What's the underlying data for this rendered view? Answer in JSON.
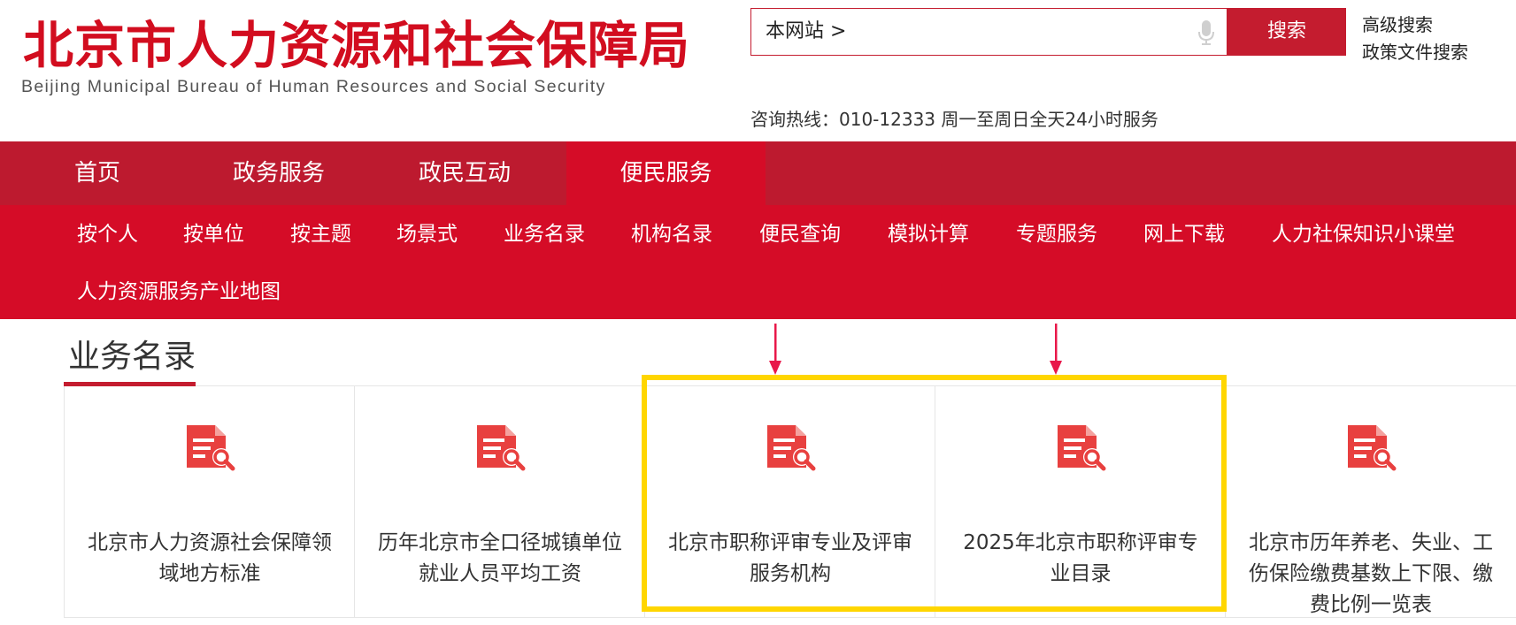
{
  "header": {
    "logo_cn": "北京市人力资源和社会保障局",
    "logo_en": "Beijing Municipal Bureau of Human Resources and Social Security",
    "search_scope": "本网站 >",
    "search_button": "搜索",
    "advanced_search": "高级搜索",
    "policy_search": "政策文件搜索",
    "hotline": "咨询热线：010-12333 周一至周日全天24小时服务"
  },
  "nav_main": {
    "tabs": [
      {
        "label": "首页"
      },
      {
        "label": "政务服务"
      },
      {
        "label": "政民互动"
      },
      {
        "label": "便民服务",
        "active": true
      }
    ]
  },
  "nav_sub": {
    "items": [
      {
        "label": "按个人"
      },
      {
        "label": "按单位"
      },
      {
        "label": "按主题"
      },
      {
        "label": "场景式"
      },
      {
        "label": "业务名录"
      },
      {
        "label": "机构名录"
      },
      {
        "label": "便民查询"
      },
      {
        "label": "模拟计算"
      },
      {
        "label": "专题服务"
      },
      {
        "label": "网上下载"
      },
      {
        "label": "人力社保知识小课堂"
      },
      {
        "label": "人力资源服务产业地图"
      }
    ]
  },
  "section": {
    "title": "业务名录"
  },
  "cards": [
    {
      "label": "北京市人力资源社会保障领域地方标准"
    },
    {
      "label": "历年北京市全口径城镇单位就业人员平均工资"
    },
    {
      "label": "北京市职称评审专业及评审服务机构"
    },
    {
      "label": "2025年北京市职称评审专业目录"
    },
    {
      "label": "北京市历年养老、失业、工伤保险缴费基数上下限、缴费比例一览表"
    }
  ],
  "colors": {
    "brand_red": "#d50c27",
    "nav_dark_red": "#bd1a2f",
    "icon_red": "#e8403f",
    "highlight_yellow": "#ffd600",
    "arrow_red": "#e8184a"
  },
  "icons": {
    "card_icon": "document-search-icon",
    "mic": "microphone-icon"
  }
}
